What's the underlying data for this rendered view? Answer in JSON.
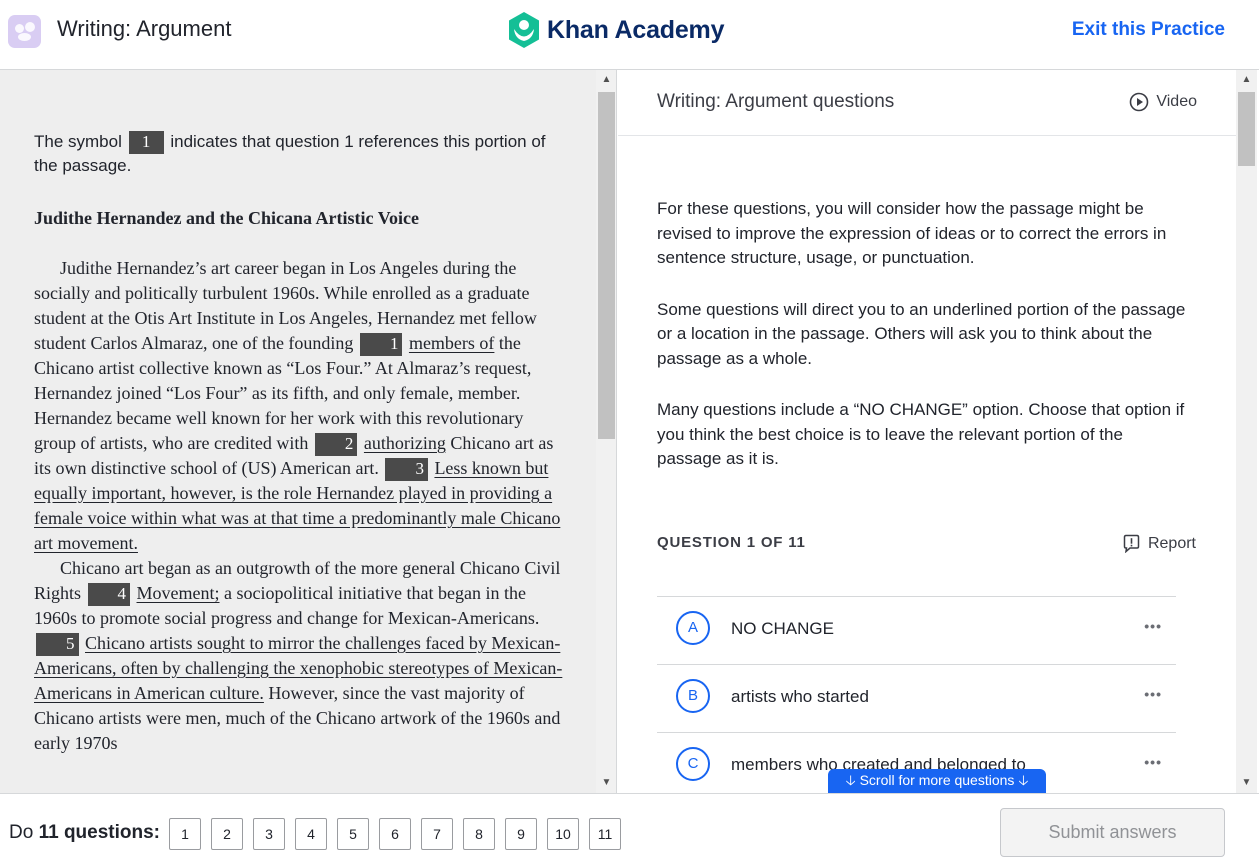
{
  "header": {
    "title": "Writing: Argument",
    "logo_text": "Khan Academy",
    "exit_label": "Exit this Practice"
  },
  "passage": {
    "intro_before": "The symbol",
    "intro_marker": "1",
    "intro_after": "indicates that question 1 references this portion of the passage.",
    "title": "Judithe Hernandez and the Chicana Artistic Voice",
    "p1_a": "Judithe Hernandez’s art career began in Los Angeles during the socially and politically turbulent 1960s. While enrolled as a graduate student at the Otis Art Institute in Los Angeles, Hernandez met fellow student Carlos Almaraz, one of the founding",
    "m1": "1",
    "u1": "members of",
    "p1_b": "the Chicano artist collective known as “Los Four.” At Almaraz’s request, Hernandez joined “Los Four” as its fifth, and only female, member. Hernandez became well known for her work with this revolutionary group of artists, who are credited with",
    "m2": "2",
    "u2": "authorizing",
    "p1_c": "Chicano art as its own distinctive school of (US) American art.",
    "m3": "3",
    "u3": "Less known but equally important, however, is the role Hernandez played in providing a female voice within what was at that time a predominantly male Chicano art movement.",
    "p2_a": "Chicano art began as an outgrowth of the more general Chicano Civil Rights",
    "m4": "4",
    "u4": "Movement;",
    "p2_b": "a sociopolitical initiative that began in the 1960s to promote social progress and change for Mexican-Americans.",
    "m5": "5",
    "u5": "Chicano artists sought to mirror the challenges faced by Mexican-Americans, often by challenging the xenophobic stereotypes of Mexican-Americans in American culture.",
    "p2_c": "However, since the vast majority of Chicano artists were men, much of the Chicano artwork of the 1960s and early 1970s"
  },
  "questions": {
    "header_title": "Writing: Argument questions",
    "video_label": "Video",
    "instructions": [
      "For these questions, you will consider how the passage might be revised to improve the expression of ideas or to correct the errors in sentence structure, usage, or punctuation.",
      "Some questions will direct you to an underlined portion of the passage or a location in the passage. Others will ask you to think about the passage as a whole.",
      "Many questions include a “NO CHANGE” option. Choose that option if you think the best choice is to leave the relevant portion of the passage as it is."
    ],
    "question_count": "QUESTION 1 OF 11",
    "report_label": "Report",
    "choices": [
      {
        "letter": "A",
        "text": "NO CHANGE",
        "more": "•••"
      },
      {
        "letter": "B",
        "text": "artists who started",
        "more": "•••"
      },
      {
        "letter": "C",
        "text": "members who created and belonged to",
        "more": "•••"
      }
    ],
    "scroll_hint": "Scroll for more questions"
  },
  "footer": {
    "label_prefix": "Do",
    "label_bold": "11 questions:",
    "question_numbers": [
      "1",
      "2",
      "3",
      "4",
      "5",
      "6",
      "7",
      "8",
      "9",
      "10",
      "11"
    ],
    "submit_label": "Submit answers"
  },
  "colors": {
    "accent": "#1865f2",
    "brand": "#0a2a66",
    "logo_green": "#14bf96",
    "passage_bg": "#eeeeee"
  }
}
